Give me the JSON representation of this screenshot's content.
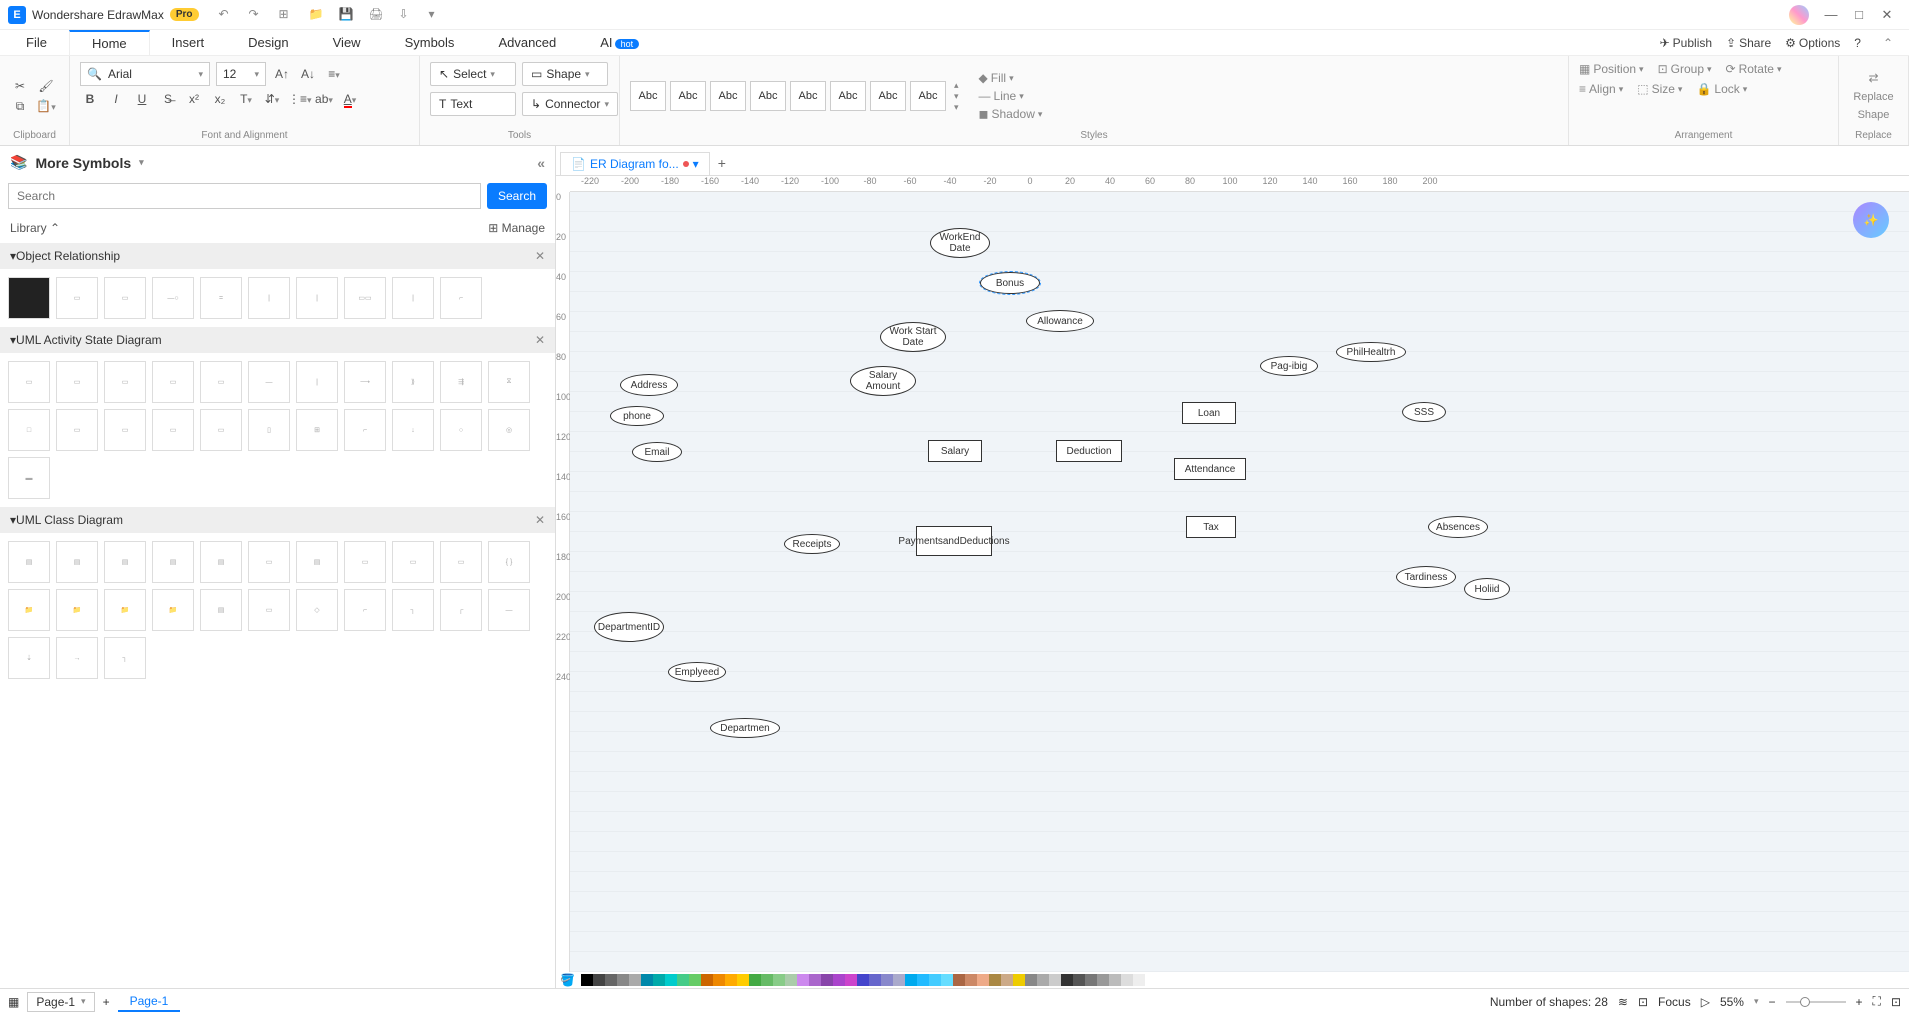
{
  "titlebar": {
    "app_name": "Wondershare EdrawMax",
    "pro_badge": "Pro"
  },
  "menubar": {
    "tabs": [
      "File",
      "Home",
      "Insert",
      "Design",
      "View",
      "Symbols",
      "Advanced",
      "AI"
    ],
    "active_index": 1,
    "ai_hot": "hot",
    "publish": "Publish",
    "share": "Share",
    "options": "Options"
  },
  "ribbon": {
    "font_name": "Arial",
    "font_size": "12",
    "select": "Select",
    "shape": "Shape",
    "text": "Text",
    "connector": "Connector",
    "fill": "Fill",
    "line": "Line",
    "shadow": "Shadow",
    "position": "Position",
    "group": "Group",
    "rotate": "Rotate",
    "align": "Align",
    "size": "Size",
    "lock": "Lock",
    "replace_shape_l1": "Replace",
    "replace_shape_l2": "Shape",
    "group_labels": {
      "clipboard": "Clipboard",
      "font_align": "Font and Alignment",
      "tools": "Tools",
      "styles": "Styles",
      "arrangement": "Arrangement",
      "replace": "Replace"
    },
    "abc": "Abc"
  },
  "sidebar": {
    "title": "More Symbols",
    "search_placeholder": "Search",
    "search_btn": "Search",
    "library_label": "Library",
    "manage_label": "Manage",
    "categories": [
      {
        "name": "Object Relationship"
      },
      {
        "name": "UML Activity State Diagram"
      },
      {
        "name": "UML Class Diagram"
      }
    ]
  },
  "document": {
    "tab_name": "ER Diagram fo...",
    "ruler_h": [
      "-220",
      "-200",
      "-180",
      "-160",
      "-140",
      "-120",
      "-100",
      "-80",
      "-60",
      "-40",
      "-20",
      "0",
      "20",
      "40",
      "60",
      "80",
      "100",
      "120",
      "140",
      "160",
      "180",
      "200"
    ],
    "ruler_v": [
      "0",
      "20",
      "40",
      "60",
      "80",
      "100",
      "120",
      "140",
      "160",
      "180",
      "200",
      "220",
      "240"
    ]
  },
  "nodes": {
    "workend": "WorkEnd Date",
    "bonus": "Bonus",
    "allowance": "Allowance",
    "workstart": "Work Start Date",
    "salary_amount": "Salary Amount",
    "address": "Address",
    "phone": "phone",
    "email": "Email",
    "salary": "Salary",
    "deduction": "Deduction",
    "loan": "Loan",
    "pagibig": "Pag-ibig",
    "philhealth": "PhilHealtrh",
    "sss": "SSS",
    "attendance": "Attendance",
    "tax": "Tax",
    "absences": "Absences",
    "tardiness": "Tardiness",
    "holiid": "Holiid",
    "receipts": "Receipts",
    "payments_deductions_l1": "Paymentsand",
    "payments_deductions_l2": "Deductions",
    "departmentid_l1": "Departmen",
    "departmentid_l2": "tID",
    "employed": "Emplyeed",
    "departmen": "Departmen"
  },
  "colors": [
    "#000",
    "#444",
    "#666",
    "#888",
    "#aaa",
    "#08a",
    "#0aa",
    "#0cc",
    "#4c8",
    "#6c6",
    "#c60",
    "#e80",
    "#fa0",
    "#fc0",
    "#4a4",
    "#6b6",
    "#8c8",
    "#aca",
    "#c8e",
    "#a6c",
    "#84a",
    "#a4c",
    "#c4c",
    "#44c",
    "#66c",
    "#88c",
    "#aac",
    "#0ae",
    "#2bf",
    "#4cf",
    "#6df",
    "#a64",
    "#c86",
    "#ea8",
    "#a84",
    "#ca8",
    "#ec0",
    "#888",
    "#aaa",
    "#ccc",
    "#333",
    "#555",
    "#777",
    "#999",
    "#bbb",
    "#ddd",
    "#eee"
  ],
  "statusbar": {
    "page_select": "Page-1",
    "page_tab": "Page-1",
    "shape_count": "Number of shapes: 28",
    "focus": "Focus",
    "zoom": "55%"
  }
}
